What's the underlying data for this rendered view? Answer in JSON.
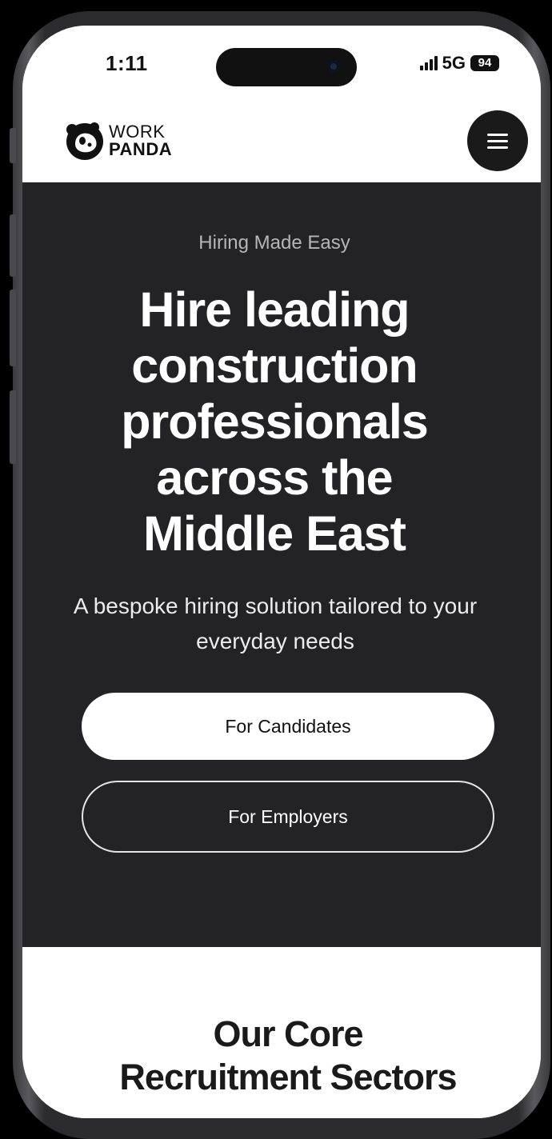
{
  "status_bar": {
    "time": "1:11",
    "network": "5G",
    "battery": "94",
    "signal_icon": "signal-bars-icon",
    "camera_icon": "front-camera-icon"
  },
  "header": {
    "logo": {
      "line1": "WORK",
      "line2": "PANDA",
      "icon": "panda-logo-icon"
    },
    "menu_icon": "hamburger-menu-icon"
  },
  "hero": {
    "eyebrow": "Hiring Made Easy",
    "title": "Hire leading construction professionals across the Middle East",
    "subtitle": "A bespoke hiring solution tailored to your everyday needs",
    "primary_cta": "For Candidates",
    "secondary_cta": "For Employers"
  },
  "sectors": {
    "title": "Our Core Recruitment Sectors"
  },
  "colors": {
    "hero_bg": "#232325",
    "page_bg": "#ffffff",
    "text_dark": "#111111",
    "eyebrow": "#b6b6b8"
  }
}
